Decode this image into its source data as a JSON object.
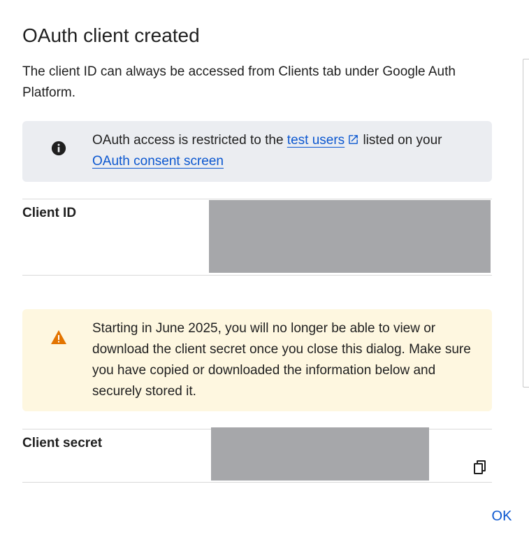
{
  "dialog": {
    "title": "OAuth client created",
    "description": "The client ID can always be accessed from Clients tab under Google Auth Platform."
  },
  "info": {
    "icon": "info-icon",
    "text_before": "OAuth access is restricted to the ",
    "link_test_users": "test users",
    "link_icon": "external-link-icon",
    "text_middle": " listed on your ",
    "link_consent": "OAuth consent screen"
  },
  "client_id": {
    "label": "Client ID"
  },
  "warning": {
    "icon": "warning-icon",
    "text": "Starting in June 2025, you will no longer be able to view or download the client secret once you close this dialog. Make sure you have copied or downloaded the information below and securely stored it."
  },
  "client_secret": {
    "label": "Client secret",
    "copy_icon": "copy-icon"
  },
  "actions": {
    "ok_label": "OK"
  },
  "colors": {
    "accent": "#0b57d0",
    "info_bg": "#ebedf1",
    "warning_bg": "#fef7e0",
    "warning_icon": "#e37400",
    "redaction": "#a6a7aa"
  }
}
